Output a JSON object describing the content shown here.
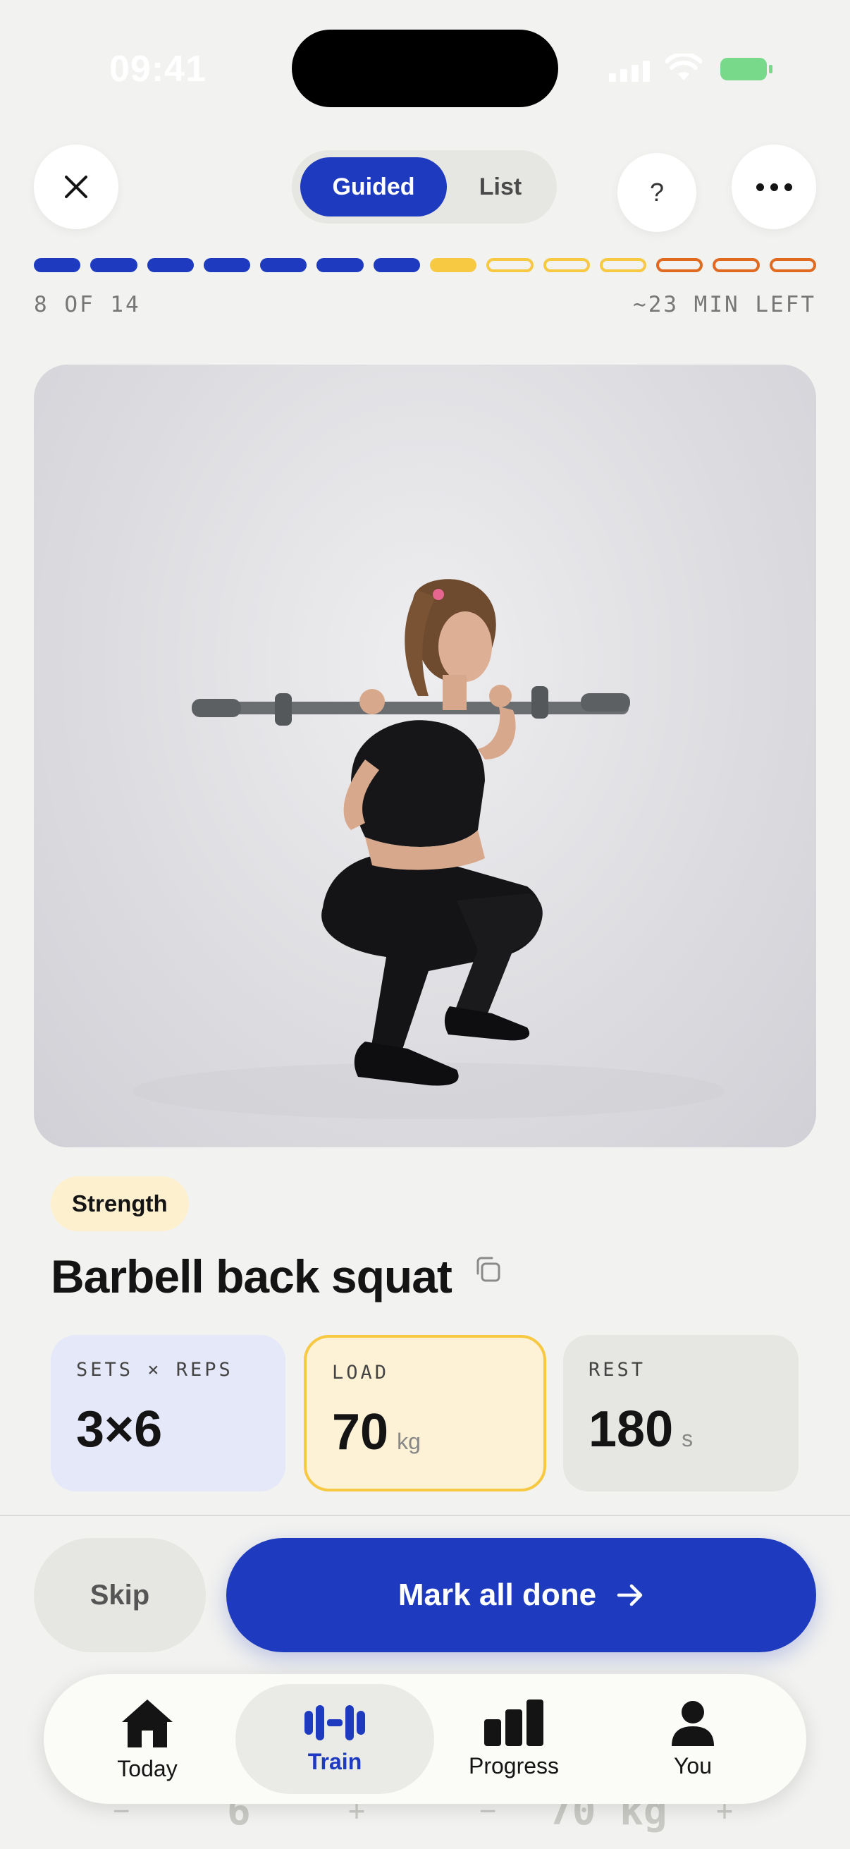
{
  "status_bar": {
    "time": "09:41"
  },
  "header": {
    "view_toggle": {
      "guided": "Guided",
      "list": "List",
      "selected": "Guided"
    },
    "help_label": "?"
  },
  "progress": {
    "position": "8 OF 14",
    "time_left": "~23 MIN LEFT",
    "current": 8,
    "total": 14,
    "colors": {
      "done": "#1e3bbf",
      "current": "#f7c842",
      "upcoming_mid": "#f7c842",
      "upcoming_end": "#e06a20"
    }
  },
  "exercise": {
    "category": "Strength",
    "name": "Barbell back squat",
    "stats": {
      "sets_reps": {
        "label": "SETS × REPS",
        "value": "3×6"
      },
      "load": {
        "label": "LOAD",
        "value": "70",
        "unit": "kg"
      },
      "rest": {
        "label": "REST",
        "value": "180",
        "unit": "s"
      }
    }
  },
  "actions": {
    "skip": "Skip",
    "mark_done": "Mark all done"
  },
  "background_stepper": {
    "minus_a": "−",
    "reps": "6",
    "plus_a": "+",
    "minus_b": "−",
    "load": "70 kg",
    "plus_b": "+"
  },
  "tab_bar": {
    "items": [
      {
        "label": "Today",
        "icon": "home-icon"
      },
      {
        "label": "Train",
        "icon": "dumbbell-icon",
        "active": true
      },
      {
        "label": "Progress",
        "icon": "bar-chart-icon"
      },
      {
        "label": "You",
        "icon": "person-icon"
      }
    ]
  },
  "colors": {
    "accent": "#1e3bbf",
    "highlight": "#f7c842",
    "background": "#f2f2f0"
  }
}
